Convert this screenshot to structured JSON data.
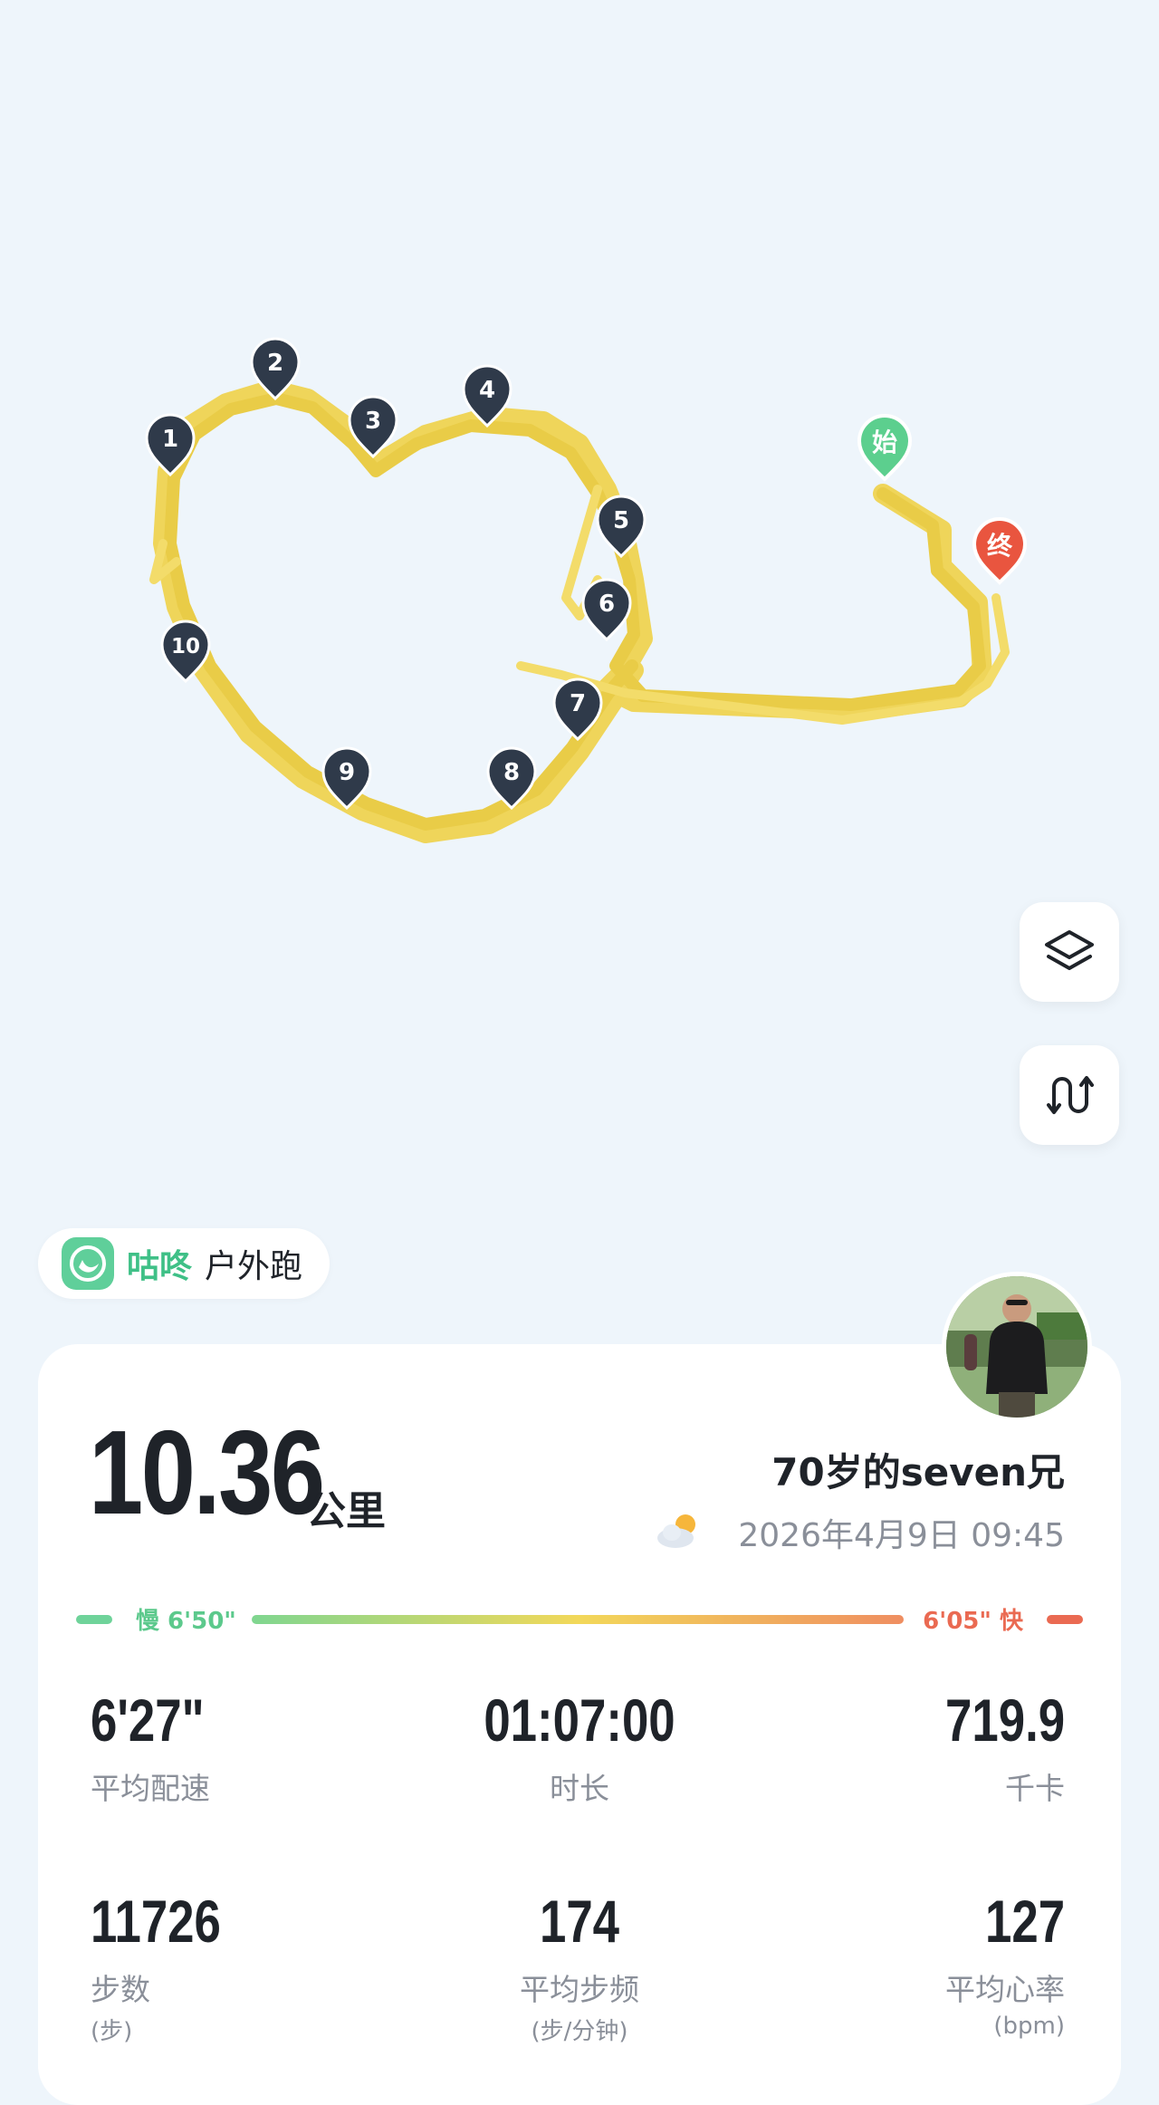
{
  "map": {
    "start_marker": "始",
    "end_marker": "终",
    "km_markers": [
      "1",
      "2",
      "3",
      "4",
      "5",
      "6",
      "7",
      "8",
      "9",
      "10"
    ],
    "route_color": "#f0d456",
    "layers_button_icon": "layers-icon",
    "route_toggle_icon": "route-icon"
  },
  "brand": {
    "name": "咕咚",
    "mode": "户外跑",
    "logo_icon": "codoon-logo-icon",
    "color": "#3fc087"
  },
  "summary": {
    "distance": "10.36",
    "distance_unit": "公里",
    "username": "70岁的seven兄",
    "datetime": "2026年4月9日 09:45",
    "weather_icon": "partly-cloudy-icon"
  },
  "pace_range": {
    "slow_label": "慢 6'50\"",
    "fast_label": "6'05\" 快",
    "slow_color": "#6fd39a",
    "fast_color": "#ea6a52"
  },
  "stats": [
    {
      "value": "6'27\"",
      "label": "平均配速",
      "sub": ""
    },
    {
      "value": "01:07:00",
      "label": "时长",
      "sub": ""
    },
    {
      "value": "719.9",
      "label": "千卡",
      "sub": ""
    },
    {
      "value": "11726",
      "label": "步数",
      "sub": "(步)"
    },
    {
      "value": "174",
      "label": "平均步频",
      "sub": "(步/分钟)"
    },
    {
      "value": "127",
      "label": "平均心率",
      "sub": "(bpm)"
    }
  ]
}
